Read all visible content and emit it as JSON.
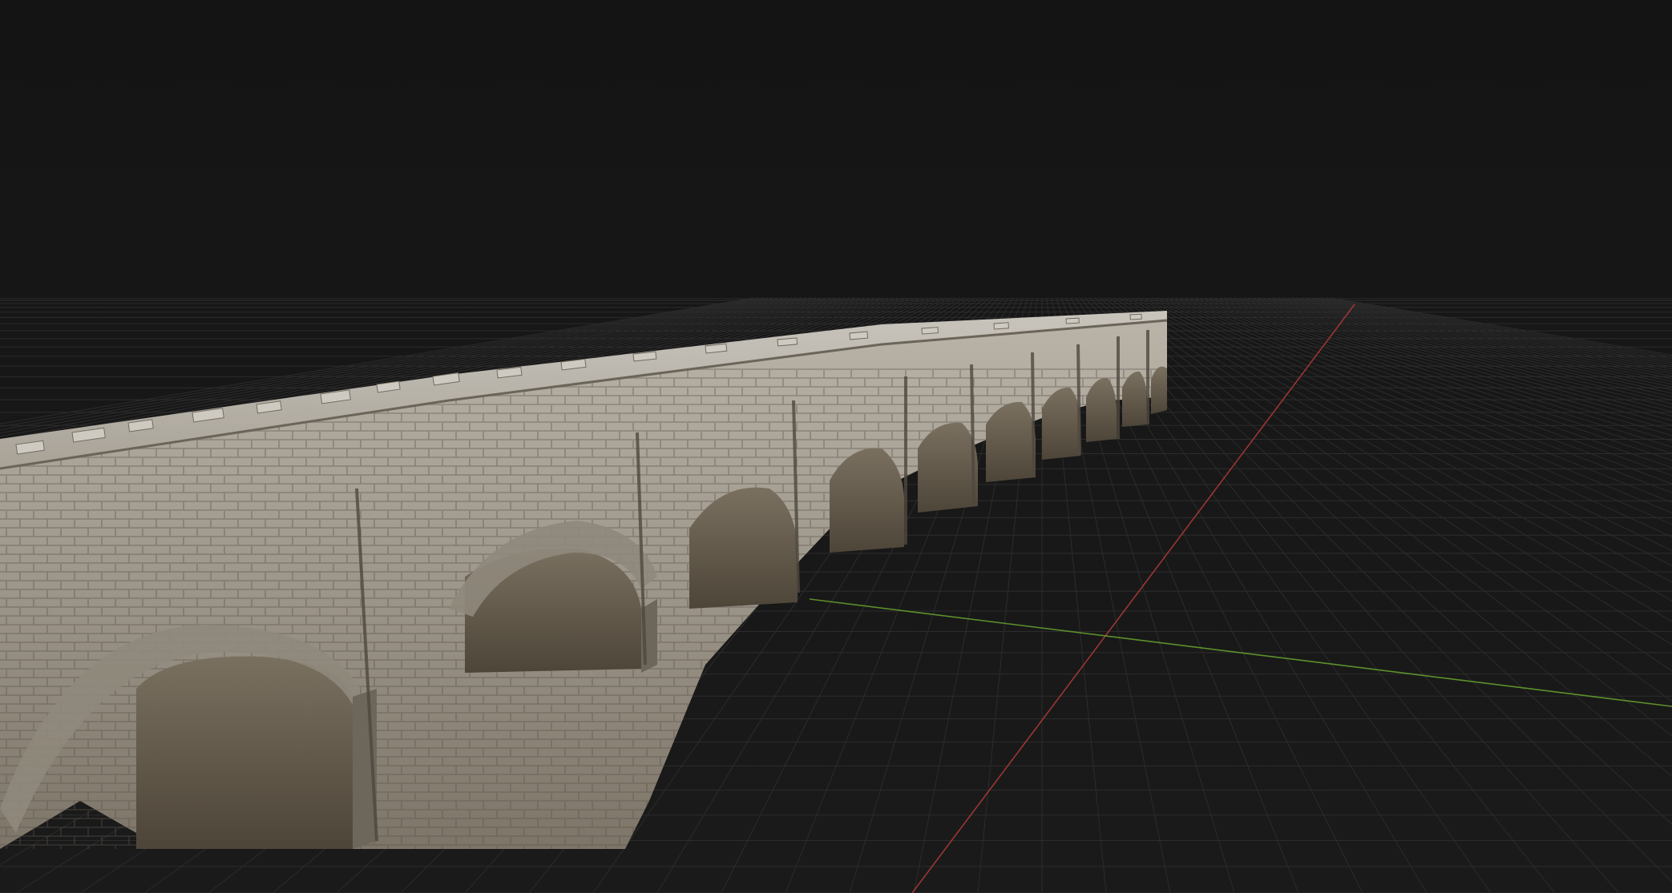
{
  "viewport": {
    "background_color": "#161616",
    "grid_color": "#2c2c2c",
    "x_axis_color": "#b33a3a",
    "y_axis_color": "#6aa52f"
  },
  "model": {
    "object_type": "stone-aqueduct",
    "stone_color": "#a9a39a",
    "stone_shadow_color": "#6b6458",
    "arch_shadow_color": "#2a2621"
  }
}
